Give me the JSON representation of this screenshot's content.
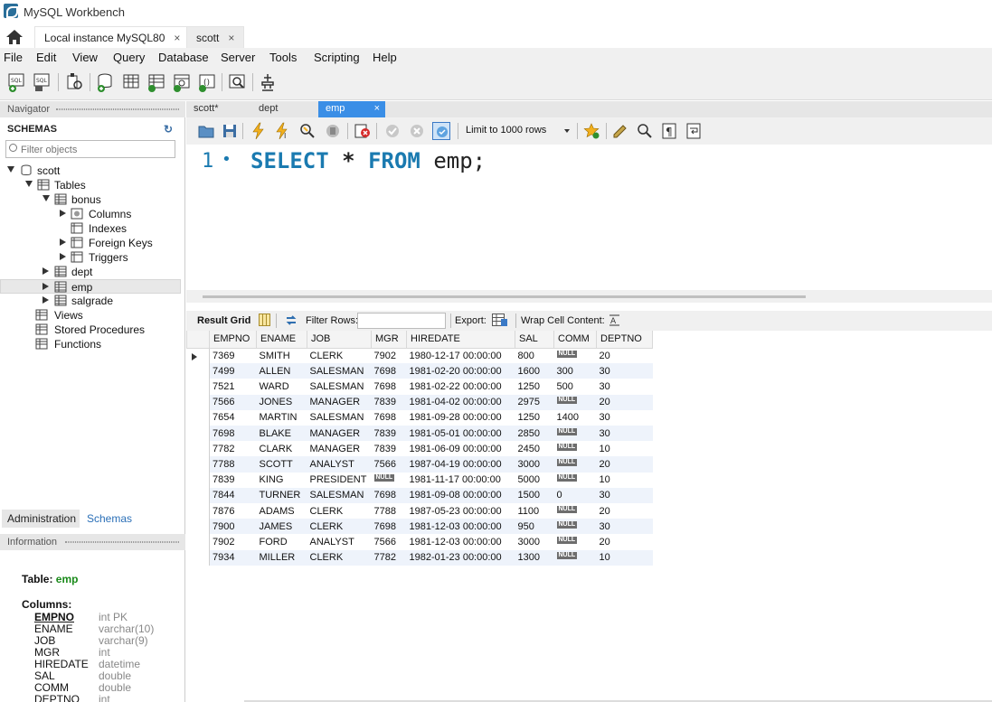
{
  "window": {
    "title": "MySQL Workbench"
  },
  "connection_tabs": [
    {
      "label": "Local instance MySQL80",
      "close": "×"
    },
    {
      "label": "scott",
      "close": "×"
    }
  ],
  "menu": [
    "File",
    "Edit",
    "View",
    "Query",
    "Database",
    "Server",
    "Tools",
    "Scripting",
    "Help"
  ],
  "navigator": {
    "header": "Navigator",
    "schemas_label": "SCHEMAS",
    "filter_placeholder": "Filter objects",
    "tree": {
      "schema": "scott",
      "tables": "Tables",
      "bonus": "bonus",
      "columns": "Columns",
      "indexes": "Indexes",
      "foreign_keys": "Foreign Keys",
      "triggers": "Triggers",
      "dept": "dept",
      "emp": "emp",
      "salgrade": "salgrade",
      "views": "Views",
      "stored_procedures": "Stored Procedures",
      "functions": "Functions"
    },
    "bottom_tabs": [
      "Administration",
      "Schemas"
    ],
    "info_header": "Information"
  },
  "info": {
    "table_label": "Table:",
    "table_name": "emp",
    "columns_label": "Columns:",
    "columns": [
      {
        "name": "EMPNO",
        "type": "int PK",
        "pk": true
      },
      {
        "name": "ENAME",
        "type": "varchar(10)"
      },
      {
        "name": "JOB",
        "type": "varchar(9)"
      },
      {
        "name": "MGR",
        "type": "int"
      },
      {
        "name": "HIREDATE",
        "type": "datetime"
      },
      {
        "name": "SAL",
        "type": "double"
      },
      {
        "name": "COMM",
        "type": "double"
      },
      {
        "name": "DEPTNO",
        "type": "int"
      }
    ]
  },
  "query_tabs": [
    {
      "label": "scott*"
    },
    {
      "label": "dept"
    },
    {
      "label": "emp",
      "active": true,
      "close": "×"
    }
  ],
  "query_toolbar": {
    "limit": "Limit to 1000 rows"
  },
  "editor": {
    "line_number": "1",
    "line_dot": "•",
    "tokens": {
      "select": "SELECT",
      "star": "*",
      "from": "FROM",
      "table": "emp",
      "semicolon": ";"
    }
  },
  "result_toolbar": {
    "result_grid": "Result Grid",
    "filter_rows": "Filter Rows:",
    "export": "Export:",
    "wrap": "Wrap Cell Content:"
  },
  "grid": {
    "columns": [
      "EMPNO",
      "ENAME",
      "JOB",
      "MGR",
      "HIREDATE",
      "SAL",
      "COMM",
      "DEPTNO"
    ],
    "null_label": "NULL",
    "rows": [
      [
        "7369",
        "SMITH",
        "CLERK",
        "7902",
        "1980-12-17 00:00:00",
        "800",
        null,
        "20"
      ],
      [
        "7499",
        "ALLEN",
        "SALESMAN",
        "7698",
        "1981-02-20 00:00:00",
        "1600",
        "300",
        "30"
      ],
      [
        "7521",
        "WARD",
        "SALESMAN",
        "7698",
        "1981-02-22 00:00:00",
        "1250",
        "500",
        "30"
      ],
      [
        "7566",
        "JONES",
        "MANAGER",
        "7839",
        "1981-04-02 00:00:00",
        "2975",
        null,
        "20"
      ],
      [
        "7654",
        "MARTIN",
        "SALESMAN",
        "7698",
        "1981-09-28 00:00:00",
        "1250",
        "1400",
        "30"
      ],
      [
        "7698",
        "BLAKE",
        "MANAGER",
        "7839",
        "1981-05-01 00:00:00",
        "2850",
        null,
        "30"
      ],
      [
        "7782",
        "CLARK",
        "MANAGER",
        "7839",
        "1981-06-09 00:00:00",
        "2450",
        null,
        "10"
      ],
      [
        "7788",
        "SCOTT",
        "ANALYST",
        "7566",
        "1987-04-19 00:00:00",
        "3000",
        null,
        "20"
      ],
      [
        "7839",
        "KING",
        "PRESIDENT",
        null,
        "1981-11-17 00:00:00",
        "5000",
        null,
        "10"
      ],
      [
        "7844",
        "TURNER",
        "SALESMAN",
        "7698",
        "1981-09-08 00:00:00",
        "1500",
        "0",
        "30"
      ],
      [
        "7876",
        "ADAMS",
        "CLERK",
        "7788",
        "1987-05-23 00:00:00",
        "1100",
        null,
        "20"
      ],
      [
        "7900",
        "JAMES",
        "CLERK",
        "7698",
        "1981-12-03 00:00:00",
        "950",
        null,
        "30"
      ],
      [
        "7902",
        "FORD",
        "ANALYST",
        "7566",
        "1981-12-03 00:00:00",
        "3000",
        null,
        "20"
      ],
      [
        "7934",
        "MILLER",
        "CLERK",
        "7782",
        "1982-01-23 00:00:00",
        "1300",
        null,
        "10"
      ]
    ]
  },
  "colors": {
    "accent": "#3a8ee6",
    "keyword": "#1a7ab0",
    "table_name": "#1a8a1a"
  }
}
